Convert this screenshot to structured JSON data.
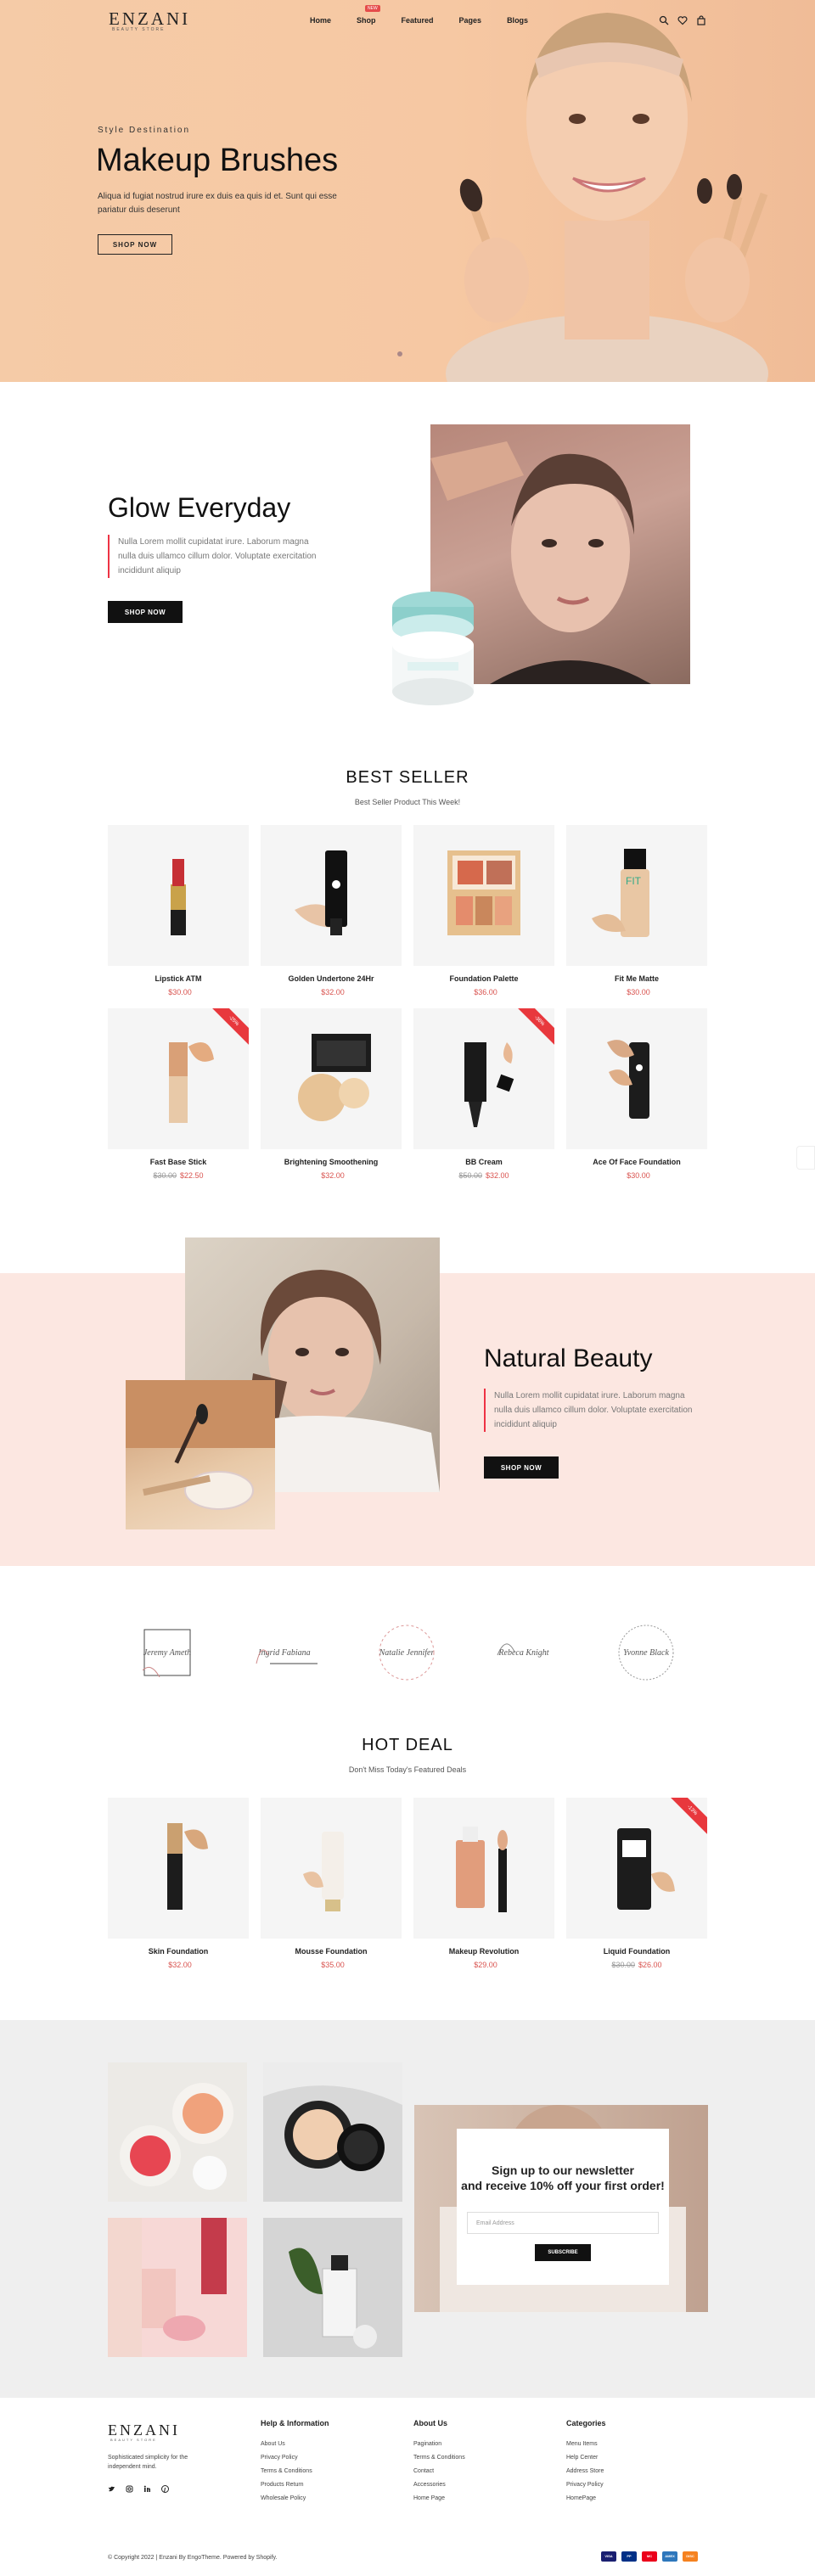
{
  "header": {
    "logo": "ENZANI",
    "logo_sub": "BEAUTY STORE",
    "nav": [
      "Home",
      "Shop",
      "Featured",
      "Pages",
      "Blogs"
    ],
    "shop_badge": "NEW",
    "icons": [
      "search-icon",
      "heart-icon",
      "bag-icon"
    ]
  },
  "hero": {
    "tag": "Style Destination",
    "title": "Makeup Brushes",
    "desc": "Aliqua id fugiat nostrud irure ex duis ea quis id et. Sunt qui esse pariatur duis deserunt",
    "button": "SHOP NOW"
  },
  "glow": {
    "title": "Glow Everyday",
    "desc": "Nulla Lorem mollit cupidatat irure. Laborum magna nulla duis ullamco cillum dolor. Voluptate exercitation incididunt aliquip",
    "button": "SHOP NOW"
  },
  "best_seller": {
    "title": "BEST SELLER",
    "subtitle": "Best Seller Product This Week!",
    "products": [
      {
        "name": "Lipstick ATM",
        "old": "",
        "price": "$30.00",
        "sale": ""
      },
      {
        "name": "Golden Undertone 24Hr",
        "old": "",
        "price": "$32.00",
        "sale": ""
      },
      {
        "name": "Foundation Palette",
        "old": "",
        "price": "$36.00",
        "sale": ""
      },
      {
        "name": "Fit Me Matte",
        "old": "",
        "price": "$30.00",
        "sale": ""
      },
      {
        "name": "Fast Base Stick",
        "old": "$30.00",
        "price": "$22.50",
        "sale": "-25%"
      },
      {
        "name": "Brightening Smoothening",
        "old": "",
        "price": "$32.00",
        "sale": ""
      },
      {
        "name": "BB Cream",
        "old": "$50.00",
        "price": "$32.00",
        "sale": "-36%"
      },
      {
        "name": "Ace Of Face Foundation",
        "old": "",
        "price": "$30.00",
        "sale": ""
      }
    ]
  },
  "natural": {
    "title": "Natural Beauty",
    "desc": "Nulla Lorem mollit cupidatat irure. Laborum magna nulla duis ullamco cillum dolor. Voluptate exercitation incididunt aliquip",
    "button": "SHOP NOW"
  },
  "brands": [
    "Jeremy Ameth",
    "Ingrid Fabiana",
    "Natalie Jennifer",
    "Rebeca Knight",
    "Yvonne Black"
  ],
  "hot_deal": {
    "title": "HOT DEAL",
    "subtitle": "Don't Miss Today's Featured Deals",
    "products": [
      {
        "name": "Skin Foundation",
        "old": "",
        "price": "$32.00",
        "sale": ""
      },
      {
        "name": "Mousse Foundation",
        "old": "",
        "price": "$35.00",
        "sale": ""
      },
      {
        "name": "Makeup Revolution",
        "old": "",
        "price": "$29.00",
        "sale": ""
      },
      {
        "name": "Liquid Foundation",
        "old": "$30.00",
        "price": "$26.00",
        "sale": "-13%"
      }
    ]
  },
  "newsletter": {
    "title_line1": "Sign up to our newsletter",
    "title_line2": "and receive 10% off your first order!",
    "placeholder": "Email Address",
    "button": "SUBSCRIBE"
  },
  "footer": {
    "logo": "ENZANI",
    "logo_sub": "BEAUTY STORE",
    "desc": "Sophisticated simplicity for the independent mind.",
    "social": [
      "twitter-icon",
      "instagram-icon",
      "linkedin-icon",
      "pinterest-icon"
    ],
    "columns": [
      {
        "title": "Help & Information",
        "links": [
          "About Us",
          "Privacy Policy",
          "Terms & Conditions",
          "Products Return",
          "Wholesale Policy"
        ]
      },
      {
        "title": "About Us",
        "links": [
          "Pagination",
          "Terms & Conditions",
          "Contact",
          "Accessories",
          "Home Page"
        ]
      },
      {
        "title": "Categories",
        "links": [
          "Menu Items",
          "Help Center",
          "Address Store",
          "Privacy Policy",
          "HomePage"
        ]
      }
    ],
    "copyright": "© Copyright 2022 | Enzani By EngoTheme. Powered by Shopify.",
    "payments": [
      "VISA",
      "PP",
      "MC",
      "AMEX",
      "DISC"
    ]
  }
}
